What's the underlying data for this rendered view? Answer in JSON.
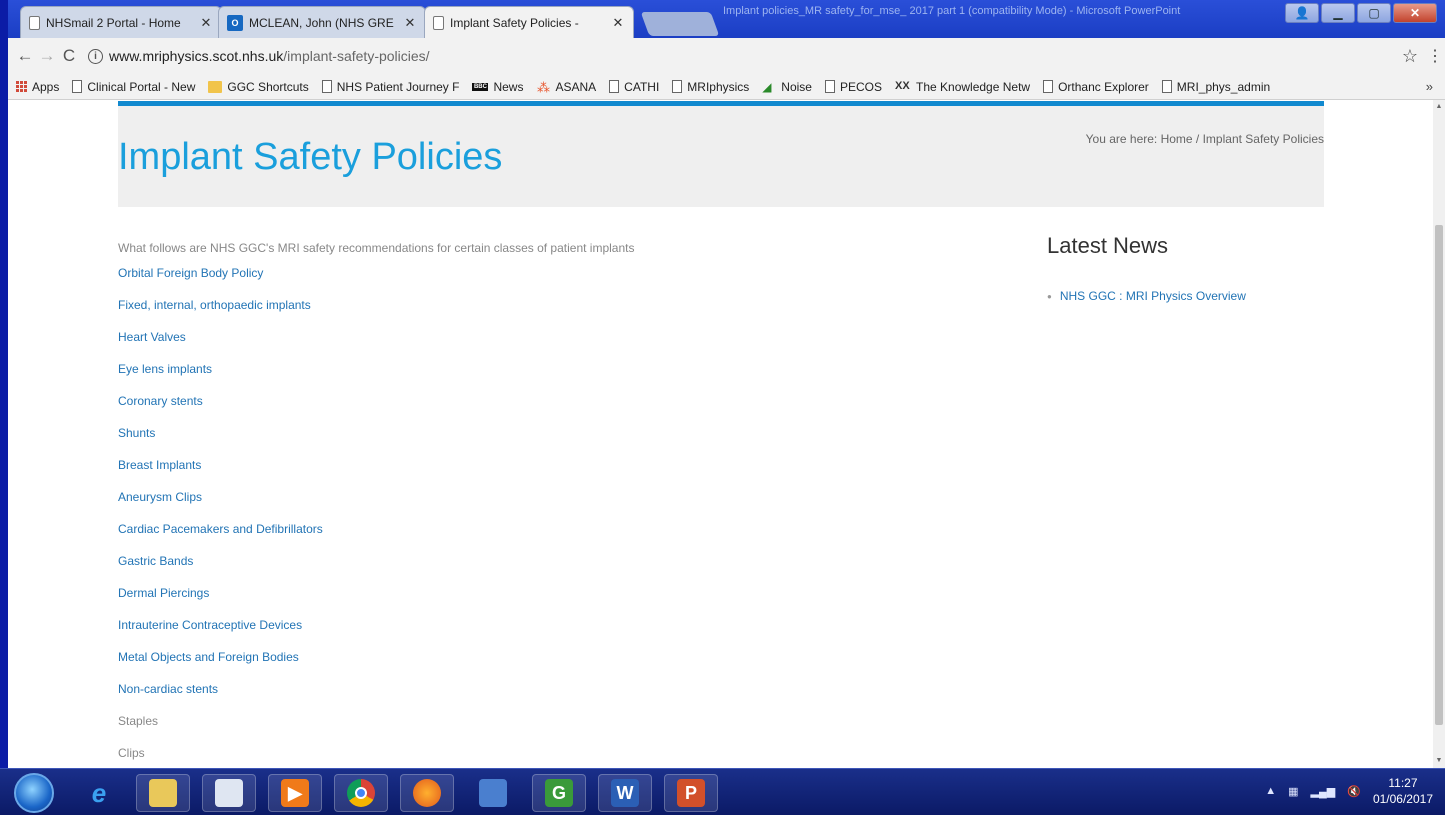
{
  "browser": {
    "tabs": [
      {
        "title": "NHSmail 2 Portal - Home",
        "icon": "page-icon",
        "active": false
      },
      {
        "title": "MCLEAN, John (NHS GRE",
        "icon": "outlook-icon",
        "active": false
      },
      {
        "title": "Implant Safety Policies - ",
        "icon": "page-icon",
        "active": true
      }
    ],
    "background_window_title": "Implant policies_MR safety_for_mse_ 2017 part 1 (compatibility Mode) - Microsoft PowerPoint",
    "url_host": "www.mriphysics.scot.nhs.uk",
    "url_path": "/implant-safety-policies/",
    "bookmarks": [
      {
        "label": "Apps",
        "icon": "apps-icon"
      },
      {
        "label": "Clinical Portal - New",
        "icon": "page-icon"
      },
      {
        "label": "GGC Shortcuts",
        "icon": "folder-icon"
      },
      {
        "label": "NHS Patient Journey F",
        "icon": "page-icon"
      },
      {
        "label": "News",
        "icon": "bbc-icon"
      },
      {
        "label": "ASANA",
        "icon": "asana-icon"
      },
      {
        "label": "CATHI",
        "icon": "page-icon"
      },
      {
        "label": "MRIphysics",
        "icon": "page-icon"
      },
      {
        "label": "Noise",
        "icon": "noise-icon"
      },
      {
        "label": "PECOS",
        "icon": "page-icon"
      },
      {
        "label": "The Knowledge Netw",
        "icon": "knowledge-network-icon"
      },
      {
        "label": "Orthanc Explorer",
        "icon": "page-icon"
      },
      {
        "label": "MRI_phys_admin",
        "icon": "page-icon"
      }
    ],
    "more_bookmarks": "»"
  },
  "page": {
    "title": "Implant Safety Policies",
    "breadcrumb": "You are here: Home / Implant Safety Policies",
    "intro": "What follows are NHS GGC's MRI safety recommendations for certain classes of patient implants",
    "policies": [
      {
        "label": "Orbital Foreign Body Policy",
        "style": "link"
      },
      {
        "label": "Fixed, internal, orthopaedic implants",
        "style": "link"
      },
      {
        "label": "Heart Valves",
        "style": "link"
      },
      {
        "label": "Eye lens implants",
        "style": "link"
      },
      {
        "label": "Coronary stents",
        "style": "link"
      },
      {
        "label": "Shunts",
        "style": "link"
      },
      {
        "label": "Breast Implants",
        "style": "link"
      },
      {
        "label": "Aneurysm Clips",
        "style": "link"
      },
      {
        "label": "Cardiac Pacemakers and Defibrillators",
        "style": "link"
      },
      {
        "label": "Gastric Bands",
        "style": "link"
      },
      {
        "label": "Dermal Piercings",
        "style": "link"
      },
      {
        "label": "Intrauterine Contraceptive Devices",
        "style": "link"
      },
      {
        "label": "Metal Objects and Foreign Bodies",
        "style": "link"
      },
      {
        "label": "Non-cardiac stents",
        "style": "link"
      },
      {
        "label": "Staples",
        "style": "grey"
      },
      {
        "label": "Clips",
        "style": "grey"
      }
    ],
    "sidebar": {
      "title": "Latest News",
      "news": [
        "NHS GGC : MRI Physics Overview"
      ]
    }
  },
  "taskbar": {
    "apps": [
      "internet-explorer-icon",
      "file-explorer-icon",
      "notepad-icon",
      "media-player-icon",
      "chrome-icon",
      "firefox-icon",
      "remote-desktop-icon",
      "g-app-icon",
      "word-icon",
      "powerpoint-icon"
    ],
    "time": "11:27",
    "date": "01/06/2017"
  },
  "colors": {
    "title_blue": "#1a9fdc",
    "link_blue": "#2274b5",
    "header_rule": "#1189cf",
    "header_bg": "#efefef"
  }
}
